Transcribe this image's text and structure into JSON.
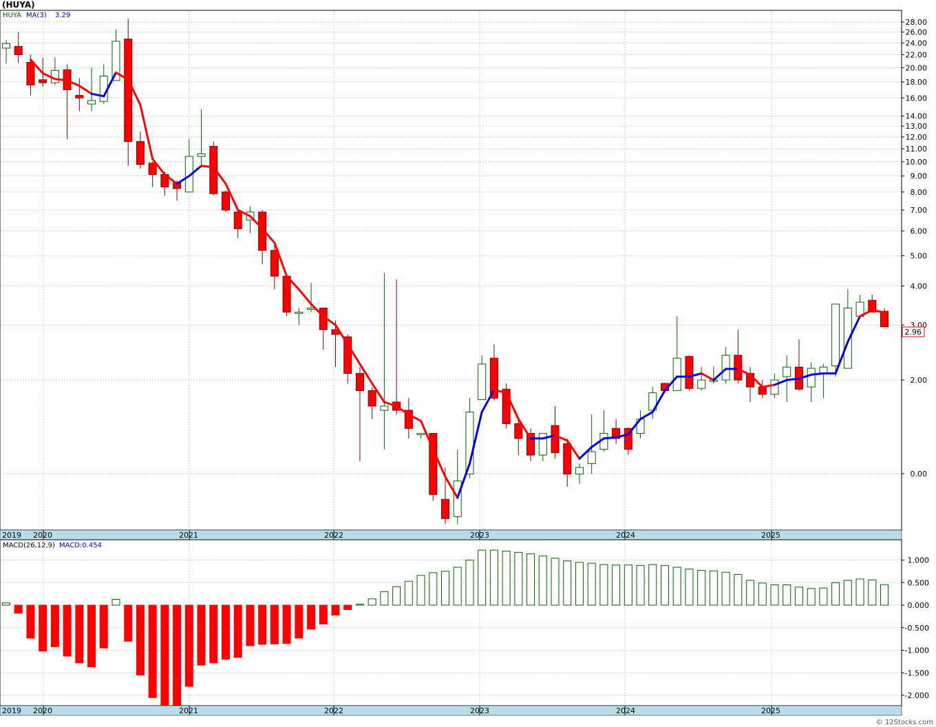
{
  "title": "(HUYA)",
  "price_legend": {
    "symbol": "HUYA",
    "ma_label": "MA(3)",
    "ma_value": "3.29"
  },
  "macd_legend": {
    "label": "MACD(26,12,9)",
    "value_label": "MACD:0.454"
  },
  "last_price_label": "2.96",
  "footer": "© 12Stocks.com",
  "colors": {
    "down": "#ff0000",
    "up_outline": "#006400",
    "ma_up": "#0000dd",
    "ma_down": "#ff0000",
    "axis_band": "#b8dde8",
    "grid": "#c8c8c8",
    "text": "#000000"
  },
  "chart_data": [
    {
      "type": "candlestick",
      "title": "(HUYA)",
      "scale": "log",
      "price_axis_ticks": [
        "28.00",
        "26.00",
        "24.00",
        "22.00",
        "20.00",
        "18.00",
        "16.00",
        "14.00",
        "13.00",
        "12.00",
        "11.00",
        "10.00",
        "9.00",
        "8.00",
        "7.00",
        "6.00",
        "5.00",
        "4.00",
        "3.00",
        "2.00",
        "0.00"
      ],
      "x_axis_labels": [
        "2019",
        "2020",
        "2021",
        "2022",
        "2023",
        "2024",
        "2025"
      ],
      "moving_average": {
        "name": "MA(3)",
        "last_value": 3.29
      },
      "last_price": 2.96,
      "candles_ohlc": [
        [
          23.1,
          24.5,
          20.6,
          23.9
        ],
        [
          23.4,
          26.0,
          20.7,
          22.0
        ],
        [
          20.8,
          22.0,
          16.3,
          17.6
        ],
        [
          18.3,
          21.5,
          17.4,
          17.9
        ],
        [
          17.9,
          21.6,
          17.6,
          19.6
        ],
        [
          19.7,
          20.5,
          11.8,
          17.0
        ],
        [
          16.3,
          18.5,
          14.5,
          16.0
        ],
        [
          15.3,
          20.0,
          14.5,
          15.7
        ],
        [
          15.6,
          20.5,
          15.3,
          18.8
        ],
        [
          18.2,
          26.5,
          18.2,
          24.3
        ],
        [
          24.7,
          28.7,
          9.7,
          11.6
        ],
        [
          11.6,
          12.5,
          9.5,
          9.8
        ],
        [
          9.9,
          10.0,
          8.3,
          9.1
        ],
        [
          9.1,
          9.3,
          7.8,
          8.3
        ],
        [
          8.6,
          8.7,
          7.5,
          8.2
        ],
        [
          8.0,
          11.8,
          8.0,
          10.4
        ],
        [
          10.4,
          14.7,
          9.6,
          10.6
        ],
        [
          11.2,
          11.6,
          7.8,
          7.9
        ],
        [
          8.0,
          8.1,
          6.9,
          7.0
        ],
        [
          6.9,
          7.1,
          5.7,
          6.1
        ],
        [
          6.5,
          7.2,
          5.9,
          6.9
        ],
        [
          6.9,
          7.0,
          4.7,
          5.2
        ],
        [
          5.2,
          5.4,
          3.9,
          4.3
        ],
        [
          4.3,
          4.3,
          3.2,
          3.3
        ],
        [
          3.3,
          3.4,
          3.0,
          3.3
        ],
        [
          3.4,
          4.1,
          3.3,
          3.4
        ],
        [
          3.4,
          3.4,
          2.5,
          2.9
        ],
        [
          2.9,
          3.1,
          2.2,
          2.8
        ],
        [
          2.75,
          2.8,
          1.95,
          2.1
        ],
        [
          2.1,
          2.2,
          1.1,
          1.85
        ],
        [
          1.85,
          1.9,
          1.5,
          1.65
        ],
        [
          1.6,
          4.4,
          1.2,
          1.65
        ],
        [
          1.7,
          4.2,
          1.55,
          1.6
        ],
        [
          1.6,
          1.75,
          1.3,
          1.4
        ],
        [
          1.35,
          1.35,
          1.3,
          1.35
        ],
        [
          1.35,
          1.35,
          0.82,
          0.86
        ],
        [
          0.83,
          1.05,
          0.69,
          0.72
        ],
        [
          0.73,
          1.2,
          0.69,
          0.95
        ],
        [
          1.0,
          1.75,
          0.97,
          1.58
        ],
        [
          1.73,
          2.4,
          1.75,
          2.25
        ],
        [
          2.35,
          2.6,
          1.72,
          1.75
        ],
        [
          1.87,
          1.95,
          1.4,
          1.45
        ],
        [
          1.45,
          1.5,
          1.15,
          1.3
        ],
        [
          1.35,
          1.4,
          1.1,
          1.15
        ],
        [
          1.15,
          1.35,
          1.1,
          1.35
        ],
        [
          1.43,
          1.65,
          1.12,
          1.17
        ],
        [
          1.25,
          1.3,
          0.91,
          1.0
        ],
        [
          1.0,
          1.08,
          0.93,
          1.05
        ],
        [
          1.08,
          1.55,
          1.0,
          1.18
        ],
        [
          1.2,
          1.6,
          1.18,
          1.35
        ],
        [
          1.4,
          1.5,
          1.25,
          1.3
        ],
        [
          1.4,
          1.41,
          1.15,
          1.2
        ],
        [
          1.35,
          1.6,
          1.3,
          1.5
        ],
        [
          1.6,
          1.9,
          1.5,
          1.82
        ],
        [
          1.95,
          1.96,
          1.82,
          1.85
        ],
        [
          1.85,
          3.2,
          1.85,
          2.35
        ],
        [
          2.38,
          2.4,
          1.85,
          1.88
        ],
        [
          1.88,
          2.2,
          1.85,
          2.0
        ],
        [
          2.0,
          2.21,
          1.95,
          2.0
        ],
        [
          2.0,
          2.55,
          1.95,
          2.4
        ],
        [
          2.4,
          2.9,
          1.95,
          2.0
        ],
        [
          2.1,
          2.2,
          1.7,
          1.9
        ],
        [
          1.9,
          2.0,
          1.75,
          1.8
        ],
        [
          1.8,
          2.1,
          1.75,
          2.0
        ],
        [
          2.05,
          2.4,
          1.7,
          2.2
        ],
        [
          2.2,
          2.7,
          1.85,
          1.87
        ],
        [
          1.9,
          2.28,
          1.7,
          2.18
        ],
        [
          2.1,
          2.25,
          1.75,
          2.2
        ],
        [
          2.22,
          3.5,
          2.05,
          3.5
        ],
        [
          2.18,
          3.9,
          2.2,
          3.4
        ],
        [
          3.2,
          3.75,
          3.15,
          3.55
        ],
        [
          3.6,
          3.75,
          3.3,
          3.3
        ],
        [
          3.32,
          3.4,
          2.95,
          2.96
        ]
      ],
      "ma3_values": [
        null,
        null,
        21.2,
        19.2,
        18.4,
        18.2,
        17.5,
        16.5,
        16.2,
        19.3,
        18.3,
        15.2,
        10.2,
        9.1,
        8.5,
        9.0,
        9.7,
        9.6,
        8.5,
        7.0,
        6.7,
        6.1,
        5.5,
        4.3,
        3.9,
        3.5,
        3.2,
        3.0,
        2.6,
        2.25,
        1.95,
        1.7,
        1.65,
        1.55,
        1.48,
        1.2,
        0.98,
        0.84,
        1.08,
        1.58,
        1.86,
        1.82,
        1.5,
        1.3,
        1.3,
        1.33,
        1.28,
        1.12,
        1.22,
        1.3,
        1.31,
        1.34,
        1.5,
        1.58,
        1.85,
        2.05,
        2.05,
        2.1,
        2.0,
        2.17,
        2.17,
        2.08,
        1.9,
        1.93,
        2.0,
        2.02,
        2.08,
        2.1,
        2.1,
        2.65,
        3.2,
        3.35,
        3.29
      ],
      "ma3_colors": [
        "",
        "",
        "down",
        "down",
        "down",
        "down",
        "down",
        "down",
        "up",
        "up",
        "down",
        "down",
        "down",
        "down",
        "down",
        "up",
        "up",
        "down",
        "down",
        "down",
        "down",
        "down",
        "down",
        "down",
        "down",
        "down",
        "down",
        "down",
        "down",
        "down",
        "down",
        "down",
        "down",
        "down",
        "down",
        "down",
        "down",
        "down",
        "up",
        "up",
        "up",
        "down",
        "down",
        "down",
        "up",
        "up",
        "down",
        "down",
        "up",
        "up",
        "up",
        "up",
        "up",
        "up",
        "up",
        "up",
        "up",
        "up",
        "down",
        "up",
        "up",
        "down",
        "down",
        "down",
        "up",
        "up",
        "up",
        "up",
        "up",
        "up",
        "up",
        "down",
        "down"
      ]
    },
    {
      "type": "bar",
      "title": "MACD(26,12,9)",
      "y_axis_ticks": [
        "1.000",
        "0.500",
        "0.000",
        "-0.500",
        "-1.000",
        "-1.500",
        "-2.000"
      ],
      "ylim": [
        -2.25,
        1.3
      ],
      "x_axis_labels": [
        "2019",
        "2020",
        "2021",
        "2022",
        "2023",
        "2024",
        "2025"
      ],
      "values": [
        0.05,
        -0.18,
        -0.73,
        -1.02,
        -0.92,
        -1.13,
        -1.28,
        -1.37,
        -0.95,
        0.13,
        -0.8,
        -1.55,
        -2.05,
        -2.25,
        -2.25,
        -1.8,
        -1.33,
        -1.28,
        -1.2,
        -1.16,
        -0.9,
        -0.87,
        -0.86,
        -0.85,
        -0.73,
        -0.53,
        -0.42,
        -0.22,
        -0.1,
        0.02,
        0.14,
        0.3,
        0.41,
        0.53,
        0.66,
        0.72,
        0.75,
        0.84,
        1.0,
        1.22,
        1.22,
        1.2,
        1.17,
        1.14,
        1.09,
        1.04,
        0.98,
        0.95,
        0.93,
        0.9,
        0.89,
        0.89,
        0.88,
        0.9,
        0.88,
        0.84,
        0.8,
        0.77,
        0.76,
        0.73,
        0.68,
        0.55,
        0.49,
        0.45,
        0.45,
        0.4,
        0.37,
        0.38,
        0.5,
        0.55,
        0.58,
        0.56,
        0.454
      ],
      "last_value": 0.454
    }
  ]
}
